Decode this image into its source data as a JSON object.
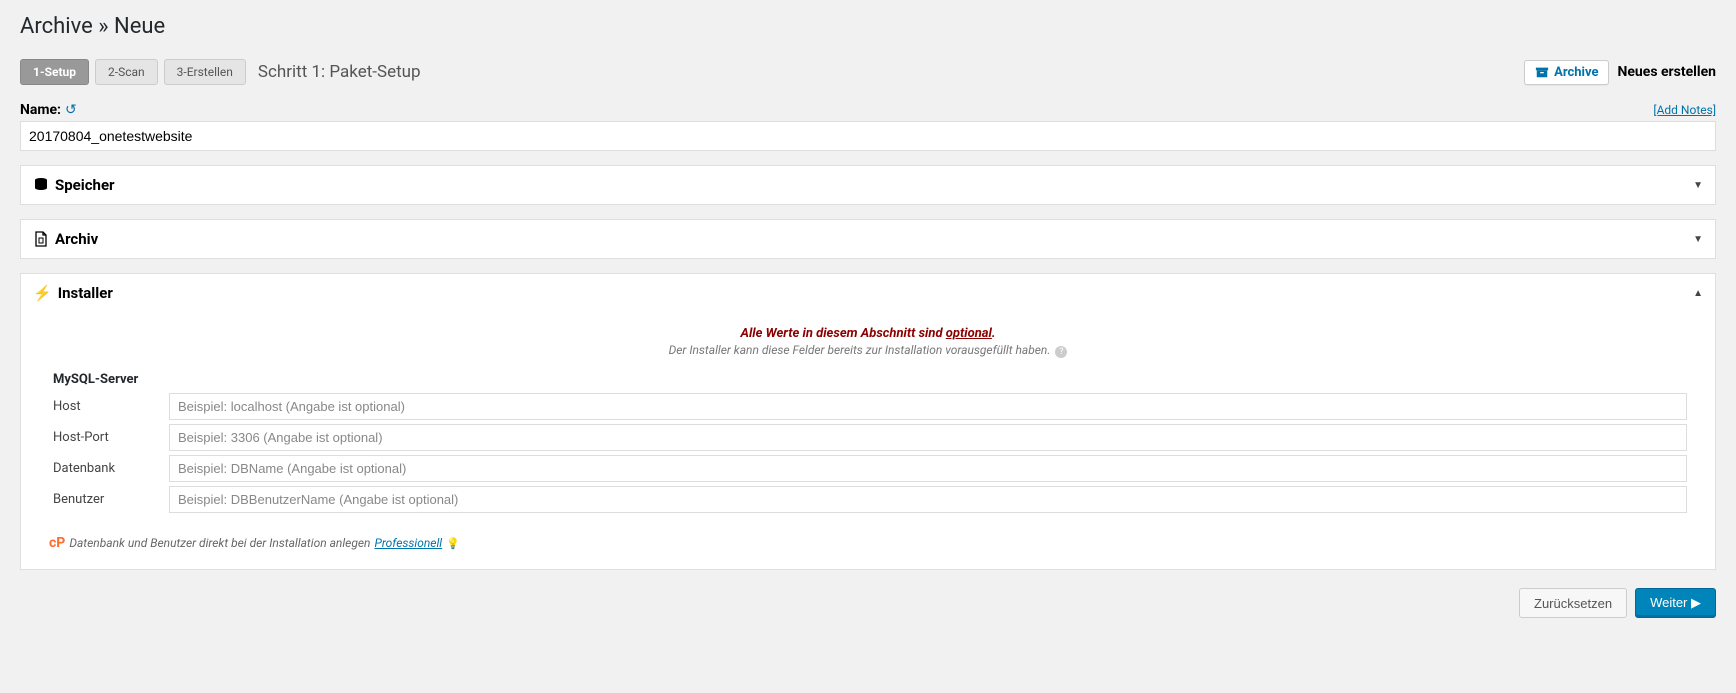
{
  "header": {
    "title": "Archive » Neue"
  },
  "tabs": {
    "setup": "1-Setup",
    "scan": "2-Scan",
    "build": "3-Erstellen",
    "step_title": "Schritt 1: Paket-Setup"
  },
  "actions": {
    "archive": "Archive",
    "create_new": "Neues erstellen"
  },
  "name": {
    "label": "Name:",
    "value": "20170804_onetestwebsite",
    "add_notes": "[Add Notes]"
  },
  "panels": {
    "storage": "Speicher",
    "archive": "Archiv",
    "installer": "Installer"
  },
  "installer_note": {
    "line1_pre": "Alle Werte in diesem Abschnitt sind ",
    "line1_bold": "optional",
    "line1_post": ".",
    "line2": "Der Installer kann diese Felder bereits zur Installation vorausgefüllt haben."
  },
  "mysql": {
    "section": "MySQL-Server",
    "host_label": "Host",
    "host_ph": "Beispiel: localhost (Angabe ist optional)",
    "port_label": "Host-Port",
    "port_ph": "Beispiel: 3306 (Angabe ist optional)",
    "db_label": "Datenbank",
    "db_ph": "Beispiel: DBName (Angabe ist optional)",
    "user_label": "Benutzer",
    "user_ph": "Beispiel: DBBenutzerName (Angabe ist optional)"
  },
  "footnote": {
    "text": "Datenbank und Benutzer direkt bei der Installation anlegen",
    "link": "Professionell"
  },
  "buttons": {
    "reset": "Zurücksetzen",
    "next": "Weiter ▶"
  }
}
